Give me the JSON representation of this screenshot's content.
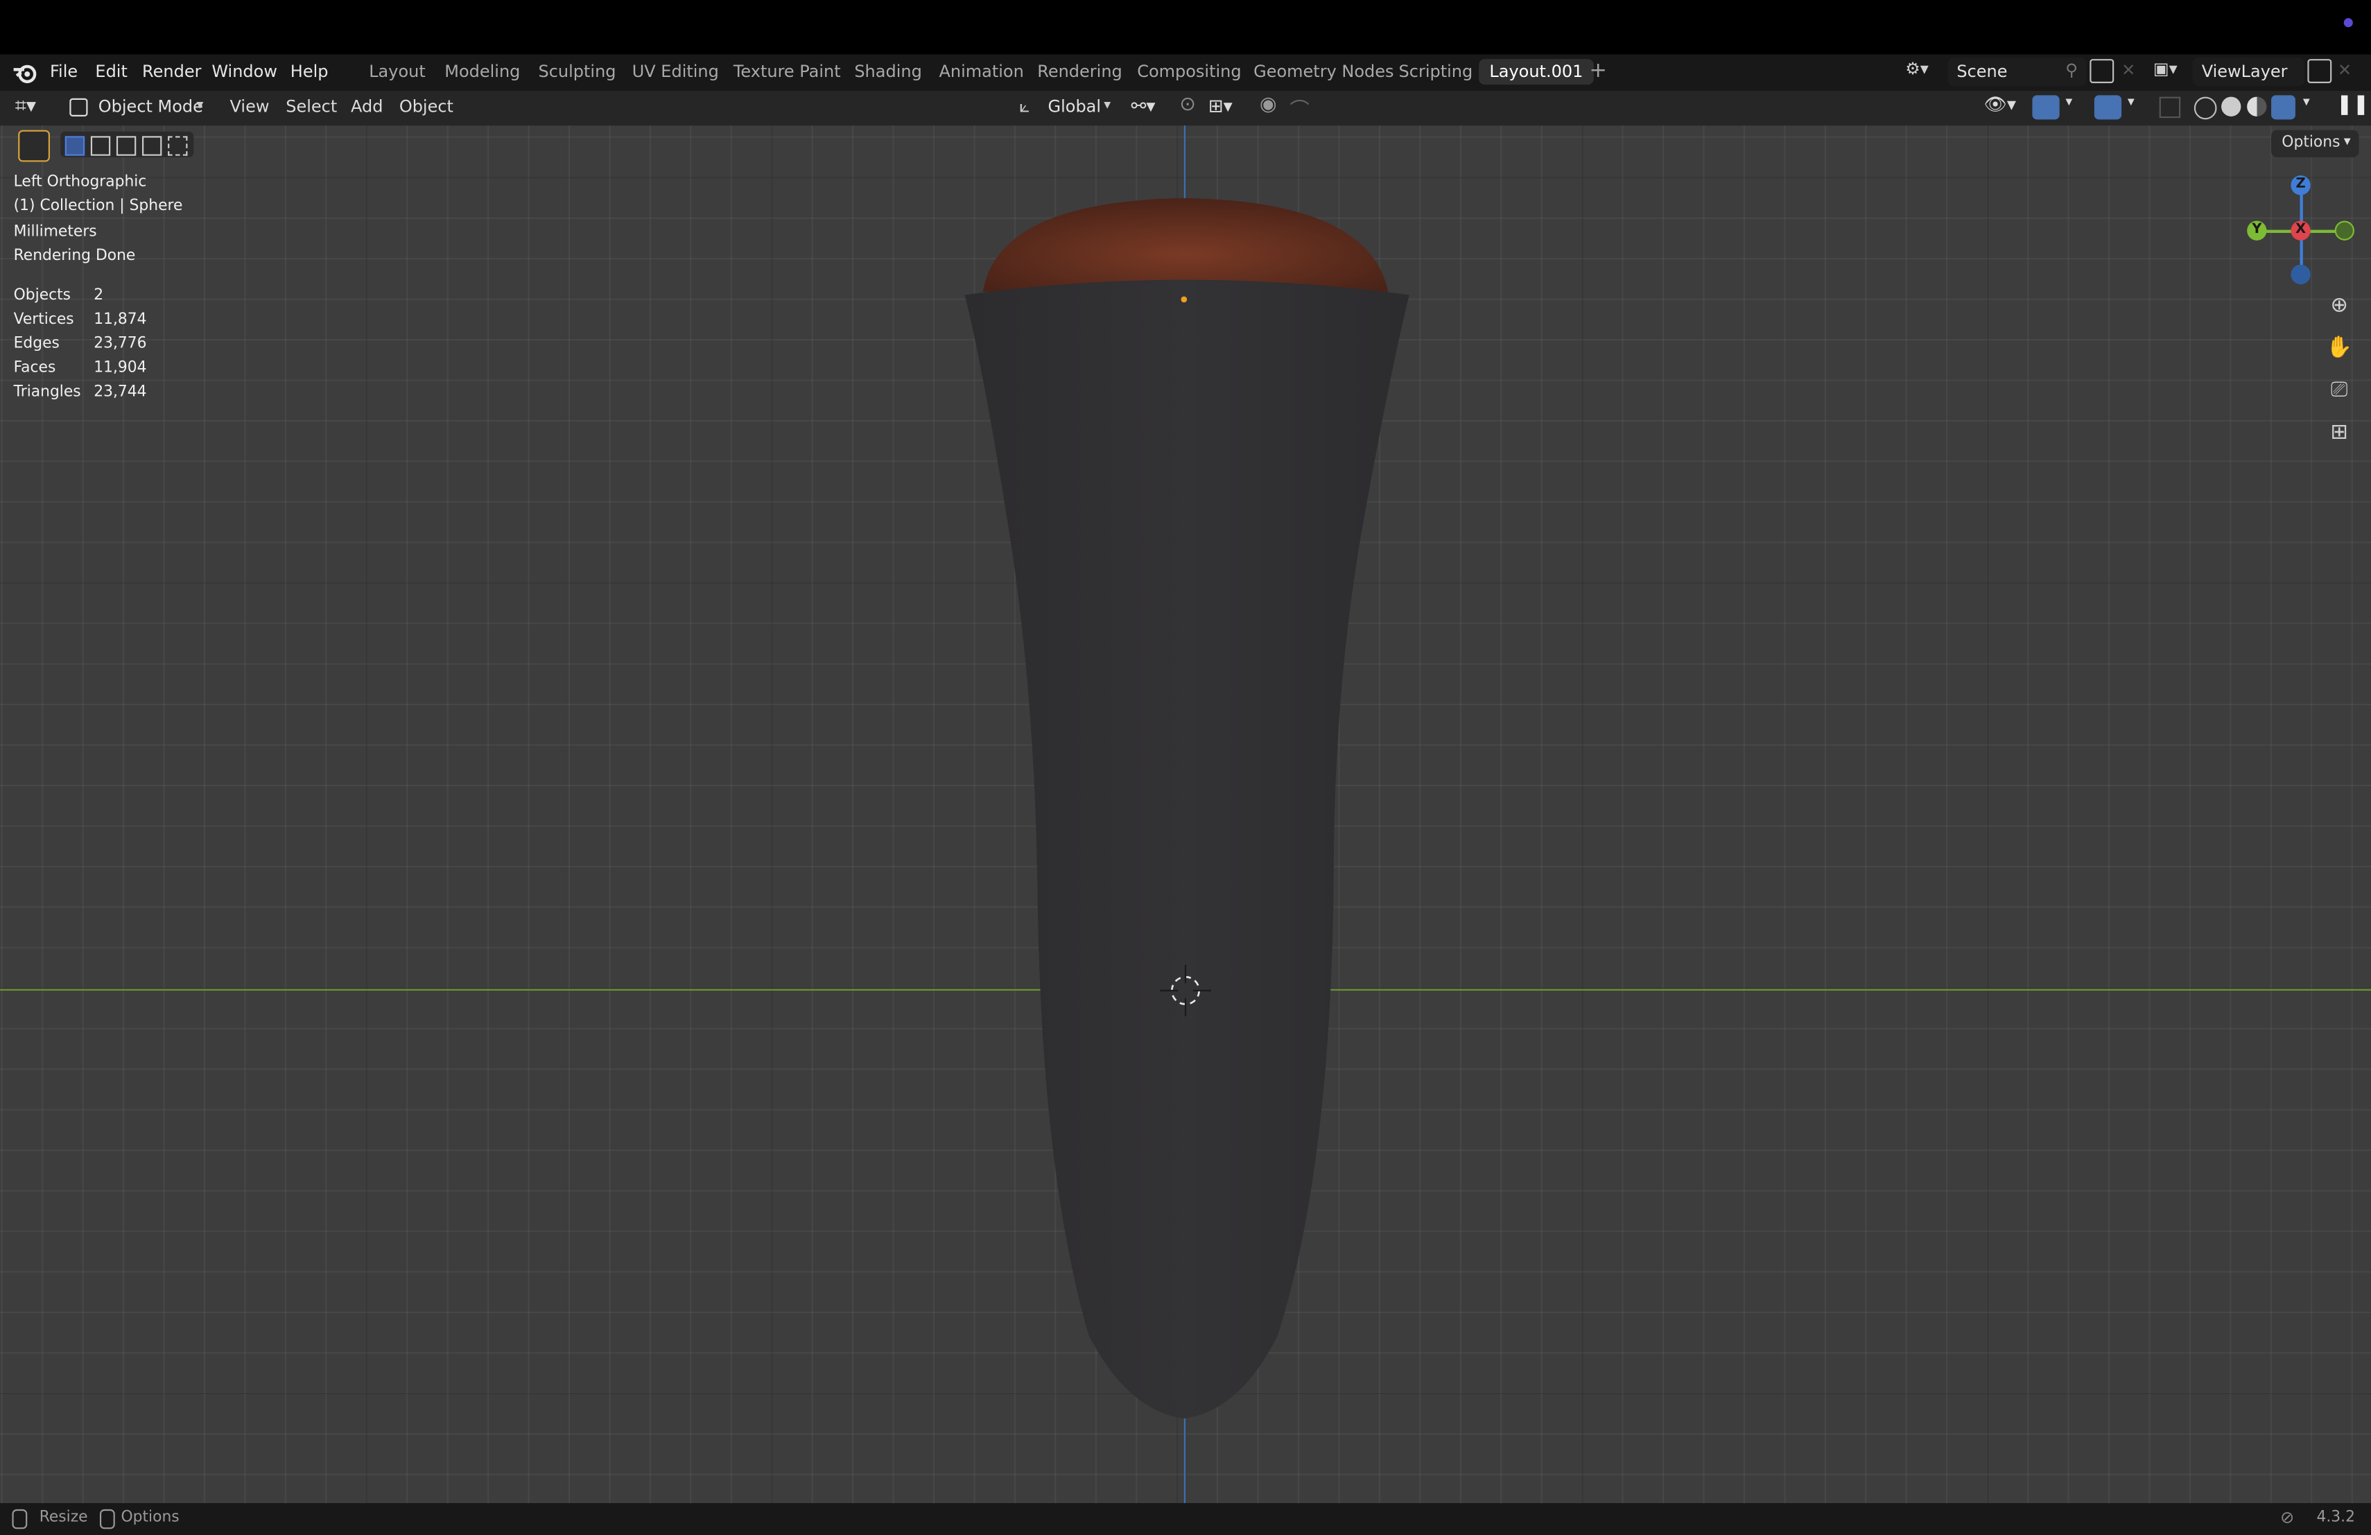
{
  "menu": {
    "file": "File",
    "edit": "Edit",
    "render": "Render",
    "window": "Window",
    "help": "Help"
  },
  "workspaces": [
    "Layout",
    "Modeling",
    "Sculpting",
    "UV Editing",
    "Texture Paint",
    "Shading",
    "Animation",
    "Rendering",
    "Compositing",
    "Geometry Nodes",
    "Scripting",
    "Layout.001"
  ],
  "active_workspace": "Layout.001",
  "scene": {
    "name": "Scene",
    "view_layer": "ViewLayer"
  },
  "header": {
    "mode": "Object Mode",
    "view": "View",
    "select": "Select",
    "add": "Add",
    "object": "Object",
    "transform_orientation": "Global",
    "options": "Options"
  },
  "overlay_info": {
    "view_name": "Left Orthographic",
    "collection": "(1) Collection | Sphere",
    "units": "Millimeters",
    "status": "Rendering Done"
  },
  "stats": [
    {
      "label": "Objects",
      "value": "2"
    },
    {
      "label": "Vertices",
      "value": "11,874"
    },
    {
      "label": "Edges",
      "value": "23,776"
    },
    {
      "label": "Faces",
      "value": "11,904"
    },
    {
      "label": "Triangles",
      "value": "23,744"
    }
  ],
  "gizmo": {
    "z": "Z",
    "y": "Y",
    "x": "X"
  },
  "statusbar": {
    "resize": "Resize",
    "options": "Options",
    "version": "4.3.2"
  },
  "colors": {
    "accent": "#4772b3",
    "axis_x": "#e0444c",
    "axis_y": "#7dbb35",
    "axis_z": "#3f7ed8",
    "object_body": "#2f2e31",
    "object_rim": "#6b3020"
  },
  "icons": [
    "blender-logo-icon",
    "editor-type-icon",
    "object-mode-icon",
    "select-box-icon",
    "transform-orientation-icon",
    "pivot-icon",
    "snap-icon",
    "proportional-edit-icon",
    "visibility-icon",
    "gizmo-icon",
    "overlay-icon",
    "xray-icon",
    "wireframe-shading-icon",
    "solid-shading-icon",
    "material-shading-icon",
    "rendered-shading-icon",
    "zoom-icon",
    "pan-hand-icon",
    "camera-icon",
    "grid-toggle-icon",
    "3d-cursor-icon",
    "pin-icon",
    "new-scene-icon",
    "close-icon",
    "add-workspace-icon",
    "mouse-icon"
  ]
}
